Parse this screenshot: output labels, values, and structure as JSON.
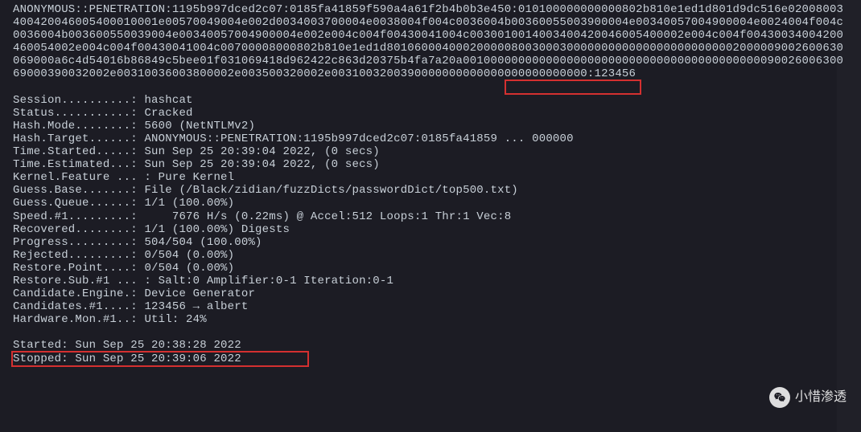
{
  "hash_dump": "ANONYMOUS::PENETRATION:1195b997dced2c07:0185fa41859f590a4a61f2b4b0b3e450:010100000000000802b810e1ed1d801d9dc516e02008003400420046005400010001e00570049004e002d0034003700004e0038004f004c0036004b00360055003900004e00340057004900004e0024004f004c0036004b003600550039004e00340057004900004e002e004c004f00430041004c0030010014003400420046005400002e004c004f00430034004200460054002e004c004f00430041004c00700008000802b810e1ed1d801060004000200000800300030000000000000000000000002000009002600630069000a6c4d54016b86849c5bee01f031069418d962422c863d20375b4fa7a20a001000000000000000000000000000000000000000009002600630069000390032002e00310036003800002e003500320002e0031003200390000000000000000000000000:123456",
  "status_lines": {
    "session_label": "Session..........: ",
    "session_value": "hashcat",
    "status_label": "Status...........: ",
    "status_value": "Cracked",
    "hashmode_label": "Hash.Mode........: ",
    "hashmode_value": "5600 (NetNTLMv2)",
    "hashtarget_label": "Hash.Target......: ",
    "hashtarget_value": "ANONYMOUS::PENETRATION:1195b997dced2c07:0185fa41859 ... 000000",
    "timestarted_label": "Time.Started.....: ",
    "timestarted_value": "Sun Sep 25 20:39:04 2022, (0 secs)",
    "timeest_label": "Time.Estimated...: ",
    "timeest_value": "Sun Sep 25 20:39:04 2022, (0 secs)",
    "kernelfeat_label": "Kernel.Feature ... : ",
    "kernelfeat_value": "Pure Kernel",
    "guessbase_label": "Guess.Base.......: ",
    "guessbase_value": "File (/Black/zidian/fuzzDicts/passwordDict/top500.txt)",
    "guessqueue_label": "Guess.Queue......: ",
    "guessqueue_value": "1/1 (100.00%)",
    "speed_label": "Speed.#1.........: ",
    "speed_value": "    7676 H/s (0.22ms) @ Accel:512 Loops:1 Thr:1 Vec:8",
    "recovered_label": "Recovered........: ",
    "recovered_value": "1/1 (100.00%) Digests",
    "progress_label": "Progress.........: ",
    "progress_value": "504/504 (100.00%)",
    "rejected_label": "Rejected.........: ",
    "rejected_value": "0/504 (0.00%)",
    "restorepoint_label": "Restore.Point....: ",
    "restorepoint_value": "0/504 (0.00%)",
    "restoresub_label": "Restore.Sub.#1 ... : ",
    "restoresub_value": "Salt:0 Amplifier:0-1 Iteration:0-1",
    "candengine_label": "Candidate.Engine.: ",
    "candengine_value": "Device Generator",
    "candidates_label": "Candidates.#1....: ",
    "candidates_value": "123456 → albert",
    "hwmon_label": "Hardware.Mon.#1..: ",
    "hwmon_value": "Util: 24%"
  },
  "footer": {
    "started_label": "Started: ",
    "started_value": "Sun Sep 25 20:38:28 2022",
    "stopped_label": "Stopped: ",
    "stopped_value": "Sun Sep 25 20:39:06 2022"
  },
  "watermark": {
    "text": "小惜渗透"
  }
}
